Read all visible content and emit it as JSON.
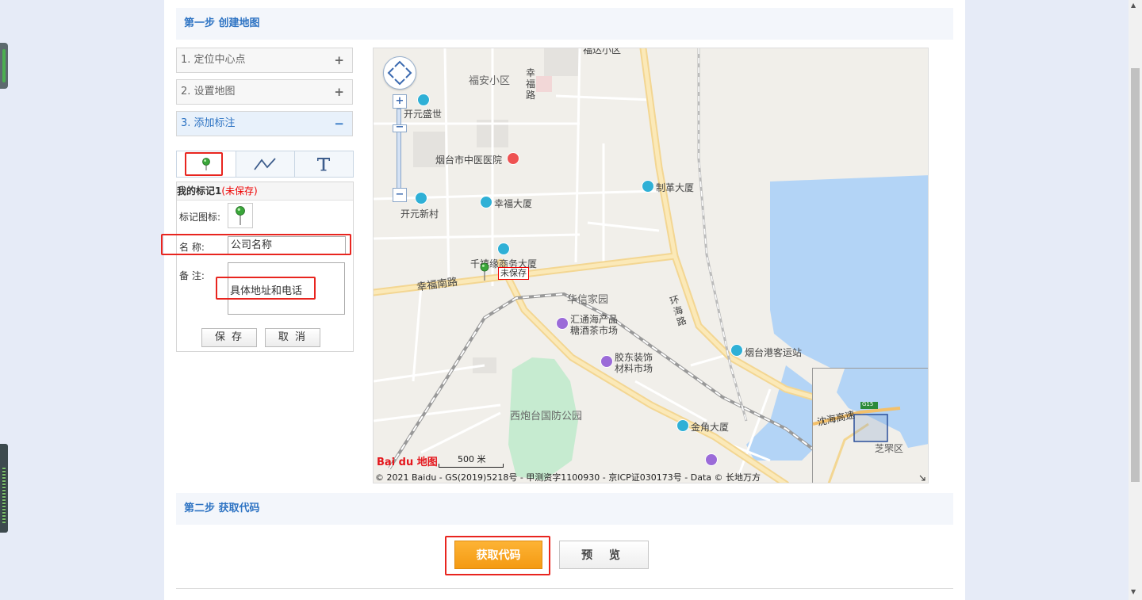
{
  "step1": {
    "title": "第一步 创建地图"
  },
  "step2": {
    "title": "第二步 获取代码"
  },
  "accordion": [
    {
      "label": "1. 定位中心点",
      "sign": "+"
    },
    {
      "label": "2. 设置地图",
      "sign": "+"
    },
    {
      "label": "3. 添加标注",
      "sign": "−"
    }
  ],
  "marker_panel": {
    "title": "我的标记1",
    "unsaved": "(未保存)",
    "icon_label": "标记图标:",
    "name_label": "名 称:",
    "name_value": "公司名称",
    "note_label": "备 注:",
    "note_value": "具体地址和电话",
    "save_button": "保 存",
    "cancel_button": "取 消"
  },
  "map": {
    "labels": {
      "fuan": "福安小区",
      "xingfu_rd": "幸福路",
      "kaiyuan_shengshi": "开元盛世",
      "hospital": "烟台市中医医院",
      "zhige": "制革大厦",
      "kaiyuan_xincun": "开元新村",
      "xingfu_building": "幸福大厦",
      "qianxi": "千禧缘商务大厦",
      "xingfu_south_rd": "幸福南路",
      "huaxin": "华信家园",
      "huanhai_rd": "环海路",
      "huitong": "汇通海产品糖酒茶市场",
      "huitong_l1": "汇通海产品",
      "huitong_l2": "糖酒茶市场",
      "jiaodong_l1": "胶东装饰",
      "jiaodong_l2": "材料市场",
      "port": "烟台港客运站",
      "xipaotai": "西炮台国防公园",
      "jinjiao": "金角大厦",
      "top_cut": "福达小区"
    },
    "unsaved_tag": "未保存",
    "scale": "500 米",
    "logo": "Bai du 地图",
    "copyright": "© 2021 Baidu - GS(2019)5218号 - 甲测资字1100930 - 京ICP证030173号 - Data © 长地万方",
    "overview_labels": {
      "highway": "沈海高速",
      "district": "芝罘区",
      "shield": "G15"
    }
  },
  "actions": {
    "get_code": "获取代码",
    "preview": "预 览"
  }
}
